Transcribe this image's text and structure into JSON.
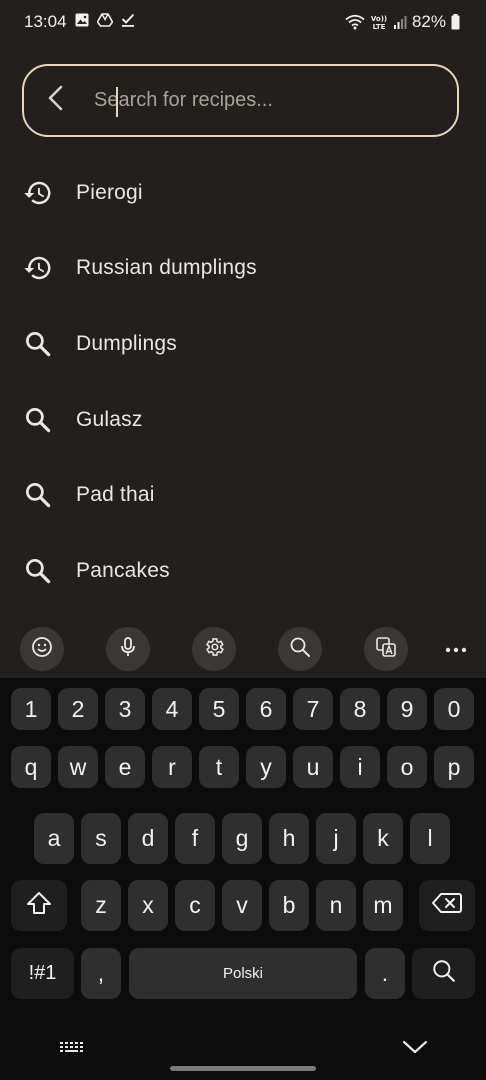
{
  "status_bar": {
    "time": "13:04",
    "battery": "82%",
    "icons": [
      "gallery-icon",
      "drive-icon",
      "check-icon",
      "wifi-icon",
      "volte-icon",
      "signal-icon",
      "battery-icon"
    ]
  },
  "search": {
    "placeholder": "Search for recipes...",
    "value": ""
  },
  "suggestions": [
    {
      "label": "Pierogi",
      "icon": "history-icon"
    },
    {
      "label": "Russian dumplings",
      "icon": "history-icon"
    },
    {
      "label": "Dumplings",
      "icon": "search-icon"
    },
    {
      "label": "Gulasz",
      "icon": "search-icon"
    },
    {
      "label": "Pad thai",
      "icon": "search-icon"
    },
    {
      "label": "Pancakes",
      "icon": "search-icon"
    }
  ],
  "keyboard": {
    "toolbar": [
      "emoji-icon",
      "microphone-icon",
      "settings-icon",
      "search-icon",
      "translate-icon",
      "more-icon"
    ],
    "row_numbers": [
      "1",
      "2",
      "3",
      "4",
      "5",
      "6",
      "7",
      "8",
      "9",
      "0"
    ],
    "row_1": [
      "q",
      "w",
      "e",
      "r",
      "t",
      "y",
      "u",
      "i",
      "o",
      "p"
    ],
    "row_2": [
      "a",
      "s",
      "d",
      "f",
      "g",
      "h",
      "j",
      "k",
      "l"
    ],
    "row_3": [
      "z",
      "x",
      "c",
      "v",
      "b",
      "n",
      "m"
    ],
    "symbols_label": "!#1",
    "comma_label": ",",
    "space_label": "Polski",
    "period_label": "."
  },
  "colors": {
    "background": "#221f1c",
    "accent_border": "#e8d6b8",
    "keyboard_bg": "#0c0c0c",
    "key_bg": "#2f2f2f"
  }
}
